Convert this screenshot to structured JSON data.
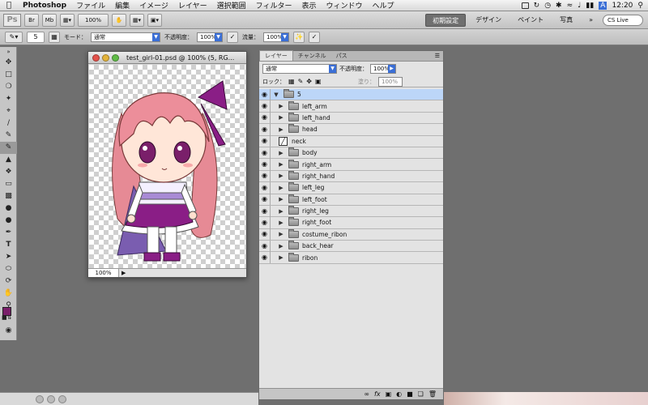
{
  "menubar": {
    "app": "Photoshop",
    "menus": [
      "ファイル",
      "編集",
      "イメージ",
      "レイヤー",
      "選択範囲",
      "フィルター",
      "表示",
      "ウィンドウ",
      "ヘルプ"
    ],
    "time": "12:20"
  },
  "appbar": {
    "zoom": "100%",
    "workspaces": [
      "初期設定",
      "デザイン",
      "ペイント",
      "写真"
    ],
    "active_workspace": "初期設定",
    "more": "»",
    "cslive": "CS Live"
  },
  "options": {
    "brush_size": "5",
    "mode_label": "モード：",
    "mode_value": "通常",
    "opacity_label": "不透明度：",
    "opacity_value": "100%",
    "flow_label": "流量：",
    "flow_value": "100%"
  },
  "document": {
    "title": "test_girl-01.psd @ 100% (5, RG...",
    "zoom": "100%"
  },
  "colors": {
    "foreground": "#7a1f6a",
    "background": "#ffffff",
    "selected_layer": "#bcd6f8"
  },
  "layers_panel": {
    "tabs": [
      "レイヤー",
      "チャンネル",
      "パス"
    ],
    "active_tab": "レイヤー",
    "blend_mode": "通常",
    "opacity_label": "不透明度：",
    "opacity_value": "100%",
    "lock_label": "ロック：",
    "fill_label": "塗り：",
    "fill_value": "100%",
    "layers": [
      {
        "name": "5",
        "type": "group",
        "expanded": true,
        "selected": true
      },
      {
        "name": "left_arm",
        "type": "group"
      },
      {
        "name": "left_hand",
        "type": "group"
      },
      {
        "name": "head",
        "type": "group"
      },
      {
        "name": "neck",
        "type": "layer"
      },
      {
        "name": "body",
        "type": "group"
      },
      {
        "name": "right_arm",
        "type": "group"
      },
      {
        "name": "right_hand",
        "type": "group"
      },
      {
        "name": "left_leg",
        "type": "group"
      },
      {
        "name": "left_foot",
        "type": "group"
      },
      {
        "name": "right_leg",
        "type": "group"
      },
      {
        "name": "right_foot",
        "type": "group"
      },
      {
        "name": "costume_ribon",
        "type": "group"
      },
      {
        "name": "back_hear",
        "type": "group"
      },
      {
        "name": "ribon",
        "type": "group"
      }
    ]
  }
}
